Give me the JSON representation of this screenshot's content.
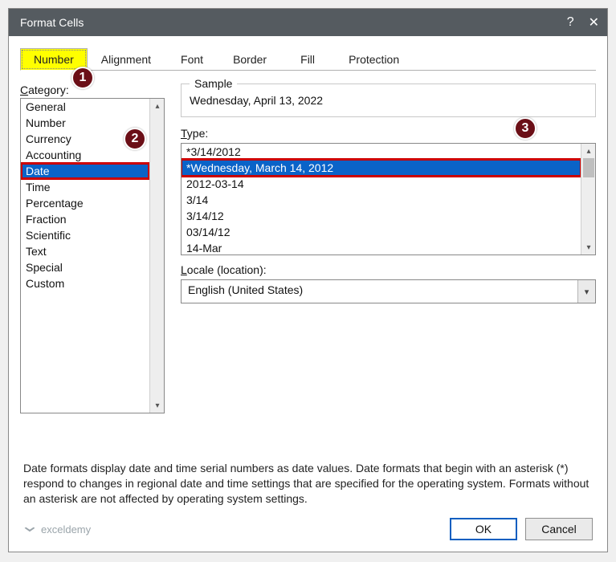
{
  "dialog": {
    "title": "Format Cells"
  },
  "tabs": {
    "number": "Number",
    "alignment": "Alignment",
    "font": "Font",
    "border": "Border",
    "fill": "Fill",
    "protection": "Protection"
  },
  "category_label_prefix": "C",
  "category_label_rest": "ategory:",
  "category_items": {
    "general": "General",
    "number": "Number",
    "currency": "Currency",
    "accounting": "Accounting",
    "date": "Date",
    "time": "Time",
    "percentage": "Percentage",
    "fraction": "Fraction",
    "scientific": "Scientific",
    "text": "Text",
    "special": "Special",
    "custom": "Custom"
  },
  "sample": {
    "legend": "Sample",
    "value": "Wednesday, April 13, 2022"
  },
  "type_label_prefix": "T",
  "type_label_rest": "ype:",
  "type_items": {
    "i0": "*3/14/2012",
    "i1": "*Wednesday, March 14, 2012",
    "i2": "2012-03-14",
    "i3": "3/14",
    "i4": "3/14/12",
    "i5": "03/14/12",
    "i6": "14-Mar"
  },
  "locale_label_prefix": "L",
  "locale_label_rest": "ocale (location):",
  "locale_value": "English (United States)",
  "description": "Date formats display date and time serial numbers as date values.  Date formats that begin with an asterisk (*) respond to changes in regional date and time settings that are specified for the operating system. Formats without an asterisk are not affected by operating system settings.",
  "buttons": {
    "ok": "OK",
    "cancel": "Cancel"
  },
  "watermark": "exceldemy",
  "badges": {
    "b1": "1",
    "b2": "2",
    "b3": "3"
  }
}
